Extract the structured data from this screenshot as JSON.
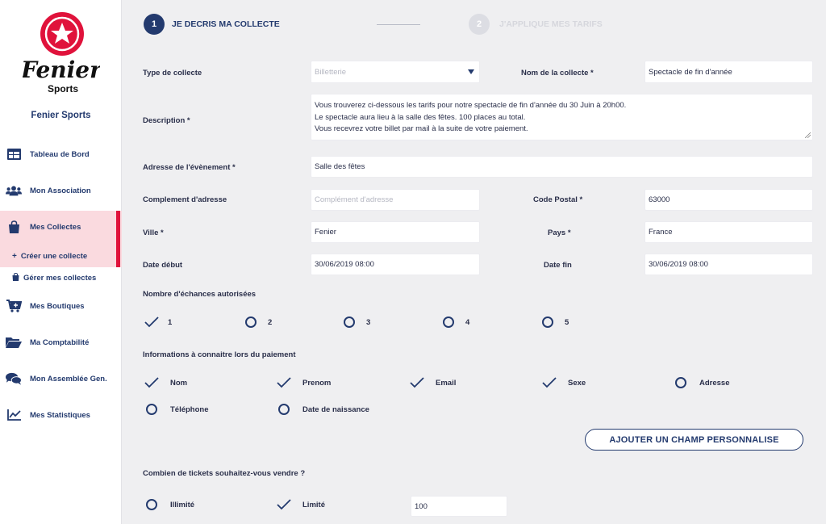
{
  "sidebar": {
    "org_name": "Fenier Sports",
    "logo_text": "Fenier",
    "logo_subtext": "Sports",
    "items": [
      {
        "label": "Tableau de Bord",
        "icon": "dashboard-icon"
      },
      {
        "label": "Mon Association",
        "icon": "users-icon"
      },
      {
        "label": "Mes Collectes",
        "icon": "shopping-bag-icon"
      },
      {
        "label": "Mes Boutiques",
        "icon": "cart-icon"
      },
      {
        "label": "Ma Comptabilité",
        "icon": "folder-icon"
      },
      {
        "label": "Mon Assemblée Gen.",
        "icon": "chat-icon"
      },
      {
        "label": "Mes Statistiques",
        "icon": "chart-line-icon"
      }
    ],
    "sub_items": [
      {
        "label": "Créer une collecte",
        "icon": "plus-icon"
      },
      {
        "label": "Gérer mes collectes",
        "icon": "bag-icon"
      }
    ],
    "colors": {
      "accent": "#e0123b",
      "active_bg": "#fadadf",
      "navy": "#233a6e"
    }
  },
  "stepper": {
    "steps": [
      {
        "number": "1",
        "label": "JE DECRIS MA COLLECTE",
        "state": "active"
      },
      {
        "number": "2",
        "label": "J'APPLIQUE MES TARIFS",
        "state": "inactive"
      }
    ]
  },
  "form": {
    "type_label": "Type de collecte",
    "type_value": "Billetterie",
    "name_label": "Nom de la collecte *",
    "name_value": "Spectacle de fin d'année",
    "description_label": "Description *",
    "description_lines": [
      "Vous trouverez ci-dessous les tarifs pour notre spectacle de fin d'année du 30 Juin à 20h00.",
      "Le spectacle aura lieu à la salle des fêtes. 100 places au total.",
      "Vous recevrez votre billet par mail à la suite de votre paiement."
    ],
    "address_label": "Adresse de l'évènement *",
    "address_value": "Salle des fêtes",
    "complement_label": "Complement d'adresse",
    "complement_placeholder": "Complément d'adresse",
    "postal_label": "Code Postal *",
    "postal_value": "63000",
    "city_label": "Ville *",
    "city_value": "Fenier",
    "country_label": "Pays *",
    "country_value": "France",
    "start_label": "Date début",
    "start_value": "30/06/2019 08:00",
    "end_label": "Date fin",
    "end_value": "30/06/2019 08:00"
  },
  "exchanges": {
    "title": "Nombre d'échances autorisées",
    "options": [
      {
        "label": "1",
        "checked": true
      },
      {
        "label": "2",
        "checked": false
      },
      {
        "label": "3",
        "checked": false
      },
      {
        "label": "4",
        "checked": false
      },
      {
        "label": "5",
        "checked": false
      }
    ]
  },
  "payment_info": {
    "title": "Informations à connaitre lors du paiement",
    "options": [
      {
        "label": "Nom",
        "checked": true
      },
      {
        "label": "Prenom",
        "checked": true
      },
      {
        "label": "Email",
        "checked": true
      },
      {
        "label": "Sexe",
        "checked": true
      },
      {
        "label": "Adresse",
        "checked": false
      },
      {
        "label": "Téléphone",
        "checked": false
      },
      {
        "label": "Date de naissance",
        "checked": false
      }
    ],
    "add_button": "AJOUTER UN CHAMP PERSONNALISE"
  },
  "tickets": {
    "title": "Combien de tickets souhaitez-vous vendre ?",
    "options": [
      {
        "label": "Illimité",
        "checked": false
      },
      {
        "label": "Limité",
        "checked": true
      }
    ],
    "quantity_value": "100"
  }
}
